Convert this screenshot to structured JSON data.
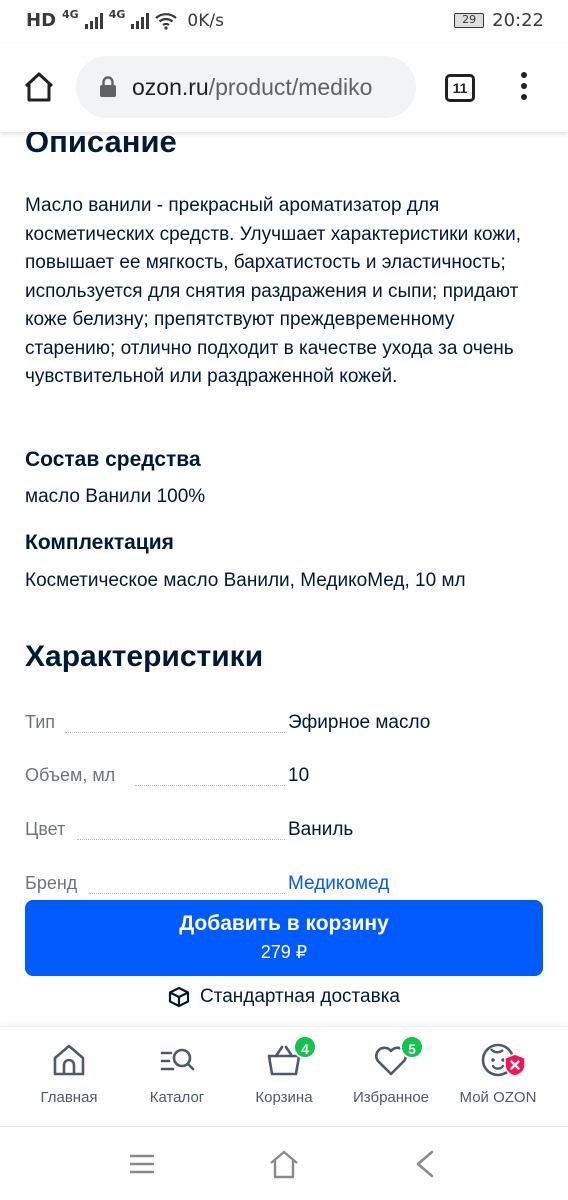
{
  "status_bar": {
    "hd": "HD",
    "net1": "4G",
    "net2": "4G",
    "speed": "0K/s",
    "battery": "29",
    "time": "20:22"
  },
  "browser": {
    "url_host": "ozon.ru",
    "url_path": "/product/mediko",
    "tab_count": "11"
  },
  "product": {
    "description_title": "Описание",
    "description_text": "Масло ванили - прекрасный ароматизатор для косметических средств. Улучшает характеристики кожи, повышает ее мягкость, бархатистость и эластичность; используется для снятия раздражения и сыпи; придают коже белизну; препятствуют преждевременному старению; отлично подходит в качестве ухода за очень чувствительной или раздраженной кожей.",
    "composition_title": "Состав средства",
    "composition_text": "масло Ванили 100%",
    "kit_title": "Комплектация",
    "kit_text": "Косметическое масло Ванили, МедикоМед, 10 мл",
    "characteristics_title": "Характеристики",
    "characteristics": [
      {
        "key": "Тип",
        "value": "Эфирное масло"
      },
      {
        "key": "Объем, мл",
        "value": "10"
      },
      {
        "key": "Цвет",
        "value": "Ваниль"
      },
      {
        "key": "Бренд",
        "value": "Медикомед"
      }
    ]
  },
  "cta": {
    "label": "Добавить в корзину",
    "price": "279 ₽",
    "delivery": "Стандартная доставка"
  },
  "bottom_nav": {
    "items": [
      {
        "label": "Главная"
      },
      {
        "label": "Каталог"
      },
      {
        "label": "Корзина",
        "badge": "4"
      },
      {
        "label": "Избранное",
        "badge": "5"
      },
      {
        "label": "Мой OZON"
      }
    ]
  },
  "colors": {
    "accent": "#005bff",
    "text": "#001a34",
    "badge": "#10c44c",
    "alert": "#f91155"
  },
  "icons": [
    "home-icon",
    "lock-icon",
    "tabs-icon",
    "more-vert-icon",
    "box-icon",
    "catalog-search-icon",
    "basket-icon",
    "heart-icon",
    "face-icon",
    "menu-icon",
    "back-icon"
  ]
}
